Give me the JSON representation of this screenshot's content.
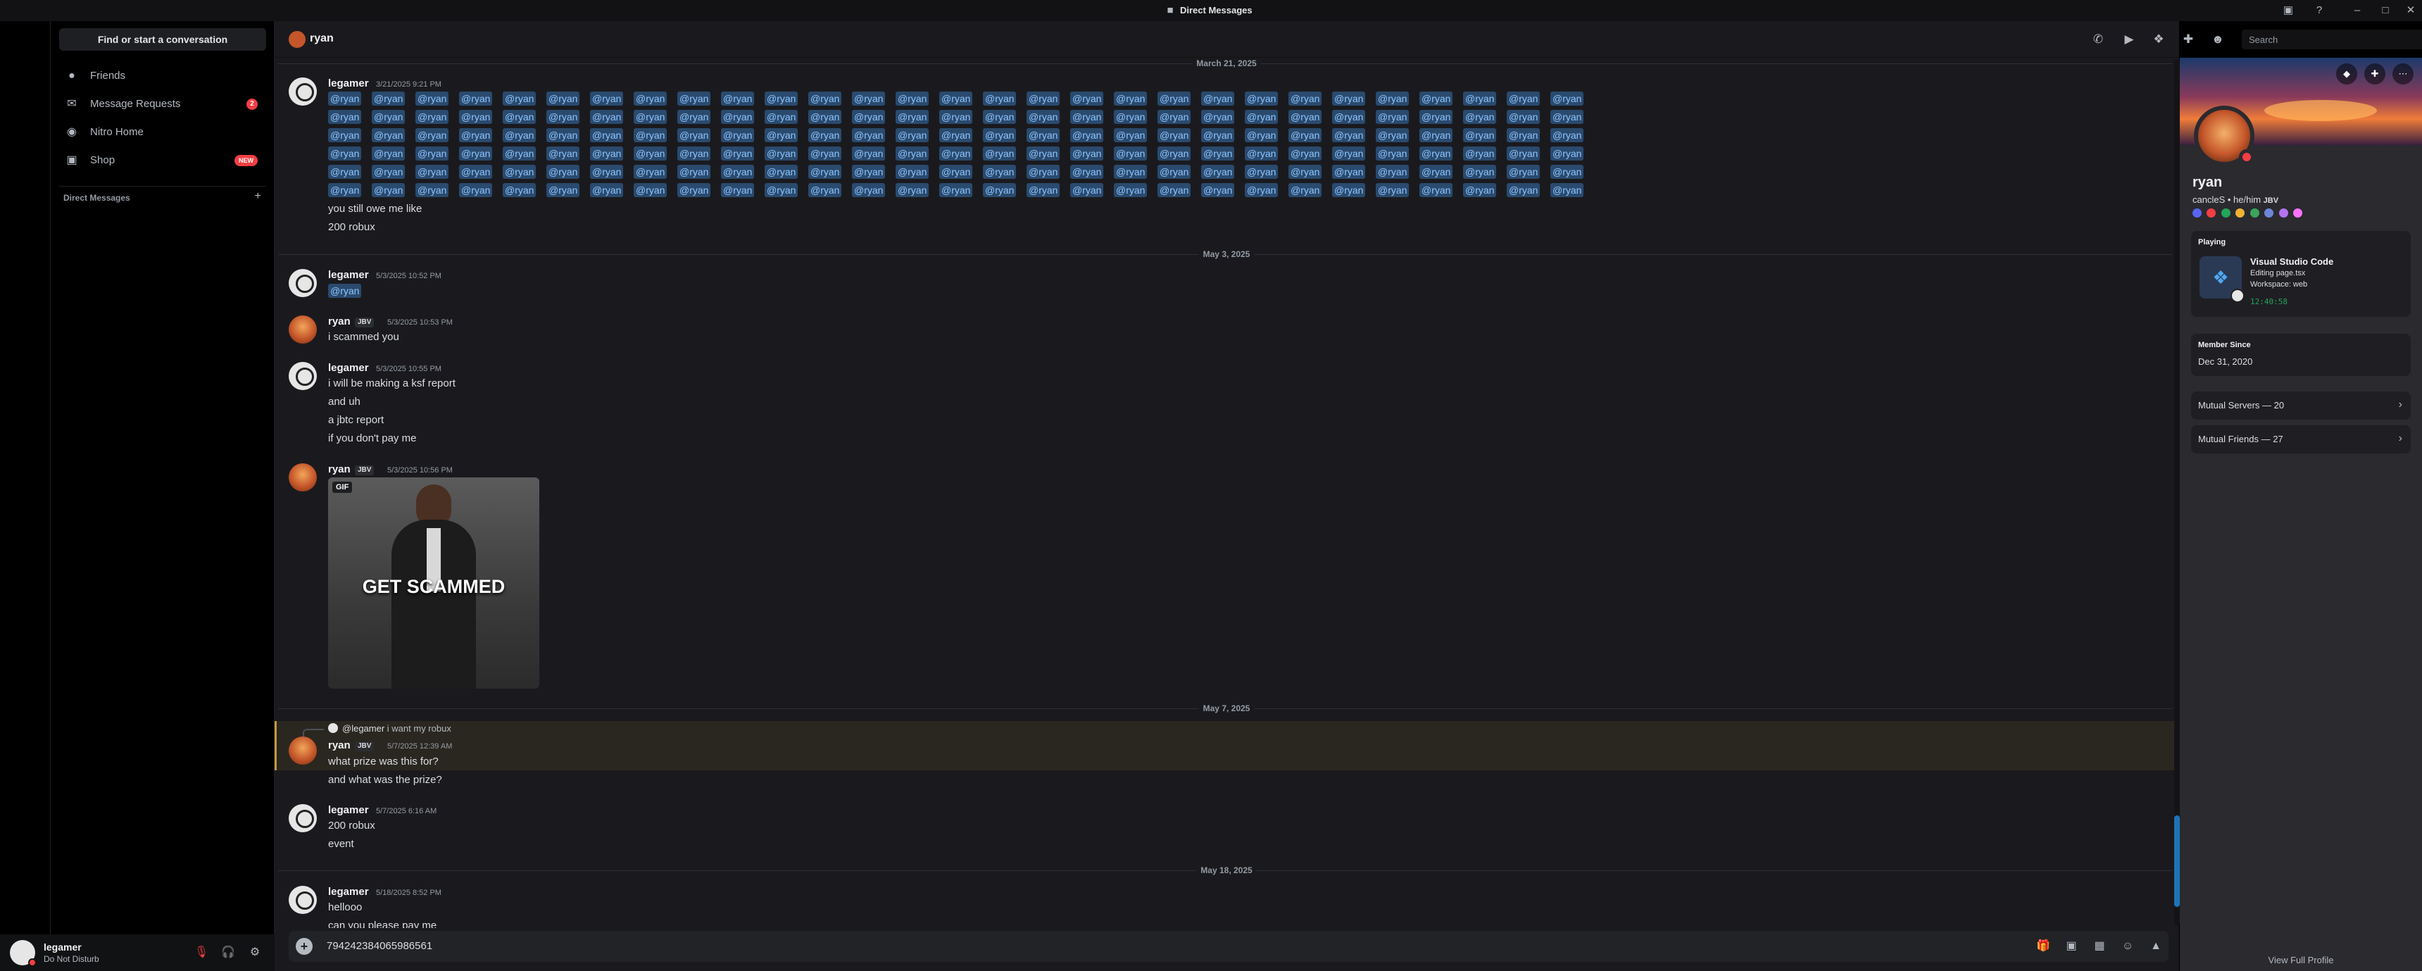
{
  "window": {
    "title": "Direct Messages"
  },
  "sidebar": {
    "find_label": "Find or start a conversation",
    "items": [
      {
        "label": "Friends",
        "icon": "friends-icon"
      },
      {
        "label": "Message Requests",
        "icon": "mail-icon",
        "badge": "2"
      },
      {
        "label": "Nitro Home",
        "icon": "nitro-icon"
      },
      {
        "label": "Shop",
        "icon": "shop-icon",
        "badge": "NEW"
      }
    ],
    "dm_header": "Direct Messages",
    "dm_add": "+"
  },
  "user_panel": {
    "name": "legamer",
    "status": "Do Not Disturb"
  },
  "header": {
    "name": "ryan",
    "search_placeholder": "Search"
  },
  "dates": [
    "March 21, 2025",
    "May 3, 2025",
    "May 7, 2025",
    "May 18, 2025"
  ],
  "mention_text": "@ryan",
  "messages": [
    {
      "author": "legamer",
      "timestamp": "3/21/2025 9:21 PM",
      "lines": [
        "you still owe me like",
        "200 robux"
      ]
    },
    {
      "author": "legamer",
      "timestamp": "5/3/2025 10:52 PM",
      "mention": "@ryan"
    },
    {
      "author": "ryan",
      "tag": "JBV",
      "timestamp": "5/3/2025 10:53 PM",
      "lines": [
        "i scammed you"
      ]
    },
    {
      "author": "legamer",
      "timestamp": "5/3/2025 10:55 PM",
      "lines": [
        "i will be making a ksf report",
        "and uh",
        "a jbtc report",
        "if you don't pay me"
      ]
    },
    {
      "author": "ryan",
      "tag": "JBV",
      "timestamp": "5/3/2025 10:56 PM",
      "gif_label": "GIF",
      "gif_text": "GET SCAMMED"
    },
    {
      "author": "ryan",
      "tag": "JBV",
      "timestamp": "5/7/2025 12:39 AM",
      "reply_to": "@legamer",
      "reply_text": "i want my robux",
      "lines": [
        "what prize was this for?",
        "and what was the prize?"
      ]
    },
    {
      "author": "legamer",
      "timestamp": "5/7/2025 6:16 AM",
      "lines": [
        "200 robux",
        "event"
      ]
    },
    {
      "author": "legamer",
      "timestamp": "5/18/2025 8:52 PM",
      "lines": [
        "hellooo",
        "can you please pay me"
      ]
    }
  ],
  "composer": {
    "value": "794242384065986561"
  },
  "profile": {
    "name": "ryan",
    "subtitle": "cancleS • he/him",
    "tag": "JBV",
    "activity": {
      "header": "Playing",
      "title": "Visual Studio Code",
      "detail": "Editing page.tsx",
      "state": "Workspace: web",
      "timer": "12:40:58"
    },
    "member_since_label": "Member Since",
    "member_since": "Dec 31, 2020",
    "mutual_servers": "Mutual Servers — 20",
    "mutual_friends": "Mutual Friends — 27",
    "view_full": "View Full Profile"
  },
  "colors": {
    "accent": "#5865f2",
    "dnd": "#f23f43",
    "mention_bg": "#2a4a6e",
    "highlight": "#c29b3c"
  }
}
